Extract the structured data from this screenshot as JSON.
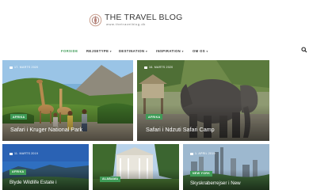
{
  "brand": {
    "title": "THE TRAVEL BLOG",
    "subtitle": "www.thetravelblog.dk"
  },
  "nav": {
    "items": [
      {
        "label": "FORSIDE",
        "active": true,
        "has_caret": false
      },
      {
        "label": "REJSETYPE",
        "active": false,
        "has_caret": true
      },
      {
        "label": "DESTINATION",
        "active": false,
        "has_caret": true
      },
      {
        "label": "INSPIRATION",
        "active": false,
        "has_caret": true
      },
      {
        "label": "OM OS",
        "active": false,
        "has_caret": true
      }
    ],
    "search_icon": "search-icon"
  },
  "featured": [
    {
      "date": "17. MARTS 2020",
      "category": "AFRIKA",
      "title": "Safari i Kruger National Park"
    },
    {
      "date": "16. MARTS 2020",
      "category": "AFRIKA",
      "title": "Safari i Ndzuti Safari Camp"
    }
  ],
  "cards": [
    {
      "date": "11. MARTS 2019",
      "category": "AFRIKA",
      "title": "Blyde Wildlife Estate i"
    },
    {
      "date": "",
      "category": "ALABAMA",
      "title": ""
    },
    {
      "date": "1. APRIL 2019",
      "category": "NEW YORK",
      "title": "Skyskraberrejser i New"
    }
  ],
  "colors": {
    "accent": "#3f9b57",
    "nav_text": "#333333"
  }
}
